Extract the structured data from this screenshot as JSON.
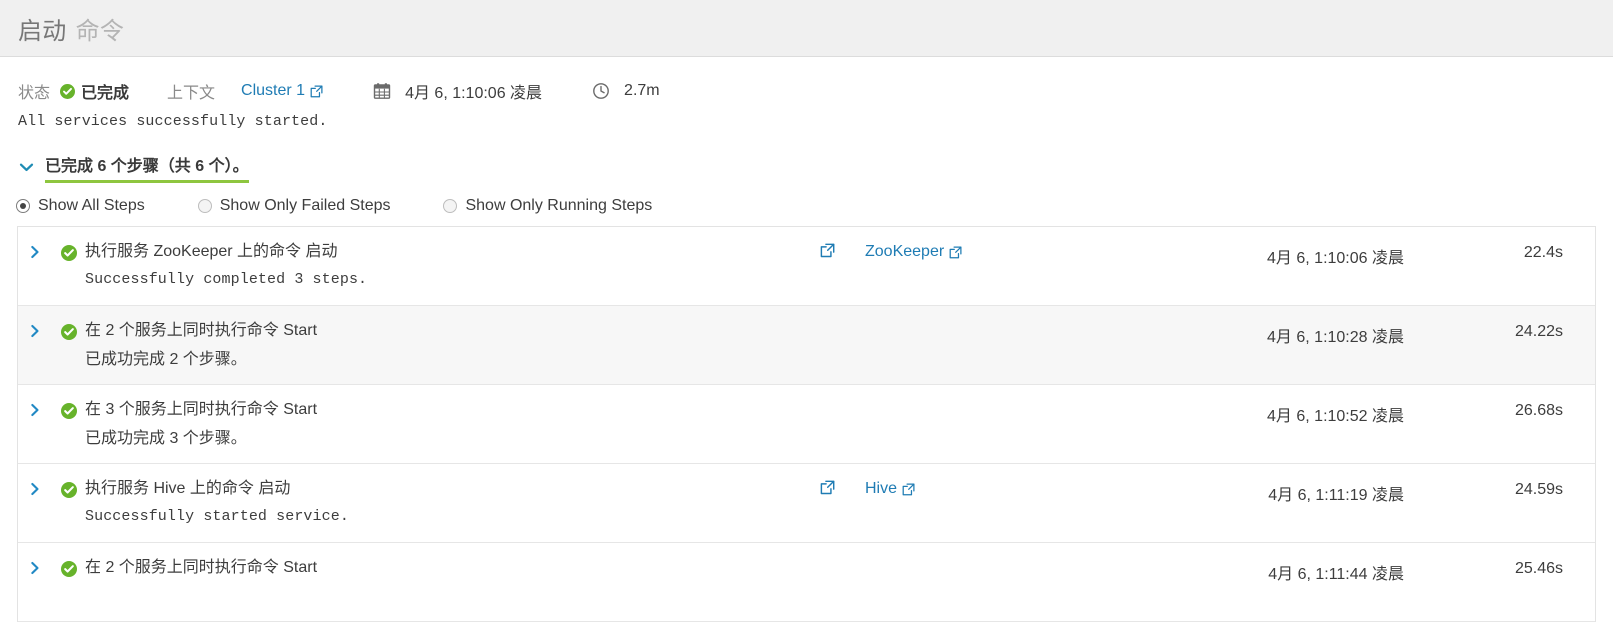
{
  "header": {
    "title_main": "启动",
    "title_sub": "命令"
  },
  "meta": {
    "status_label": "状态",
    "status_value": "已完成",
    "status_icon": "check-circle-icon",
    "context_label": "上下文",
    "context_link": "Cluster 1",
    "context_link_icon": "external-link-icon",
    "calendar_icon": "calendar-icon",
    "start_time": "4月 6, 1:10:06 凌晨",
    "clock_icon": "clock-icon",
    "duration": "2.7m"
  },
  "description": "All services successfully started.",
  "steps_section": {
    "chevron_icon": "chevron-down-icon",
    "summary": "已完成 6 个步骤（共 6 个）。",
    "underline_color": "#8ec63f",
    "filters": [
      {
        "label": "Show All Steps",
        "selected": true
      },
      {
        "label": "Show Only Failed Steps",
        "selected": false
      },
      {
        "label": "Show Only Running Steps",
        "selected": false
      }
    ]
  },
  "steps_table": {
    "rows": [
      {
        "expand_icon": "chevron-right-icon",
        "state_icon": "check-circle-icon",
        "title": "执行服务 ZooKeeper 上的命令 启动",
        "subtitle": "Successfully completed 3 steps.",
        "subtitle_mono": true,
        "detail_icon": "external-link-icon",
        "service_link": "ZooKeeper",
        "service_link_icon": "external-link-icon",
        "time": "4月 6, 1:10:06 凌晨",
        "duration": "22.4s",
        "alt": false
      },
      {
        "expand_icon": "chevron-right-icon",
        "state_icon": "check-circle-icon",
        "title": "在 2 个服务上同时执行命令 Start",
        "subtitle": "已成功完成 2 个步骤。",
        "subtitle_mono": false,
        "detail_icon": "",
        "service_link": "",
        "service_link_icon": "",
        "time": "4月 6, 1:10:28 凌晨",
        "duration": "24.22s",
        "alt": true
      },
      {
        "expand_icon": "chevron-right-icon",
        "state_icon": "check-circle-icon",
        "title": "在 3 个服务上同时执行命令 Start",
        "subtitle": "已成功完成 3 个步骤。",
        "subtitle_mono": false,
        "detail_icon": "",
        "service_link": "",
        "service_link_icon": "",
        "time": "4月 6, 1:10:52 凌晨",
        "duration": "26.68s",
        "alt": false
      },
      {
        "expand_icon": "chevron-right-icon",
        "state_icon": "check-circle-icon",
        "title": "执行服务 Hive 上的命令 启动",
        "subtitle": "Successfully started service.",
        "subtitle_mono": true,
        "detail_icon": "external-link-icon",
        "service_link": "Hive",
        "service_link_icon": "external-link-icon",
        "time": "4月 6, 1:11:19 凌晨",
        "duration": "24.59s",
        "alt": false
      },
      {
        "expand_icon": "chevron-right-icon",
        "state_icon": "check-circle-icon",
        "title": "在 2 个服务上同时执行命令 Start",
        "subtitle": "",
        "subtitle_mono": false,
        "detail_icon": "",
        "service_link": "",
        "service_link_icon": "",
        "time": "4月 6, 1:11:44 凌晨",
        "duration": "25.46s",
        "alt": false
      }
    ]
  },
  "colors": {
    "link": "#1f7cb4",
    "success": "#67b32b",
    "underline": "#8ec63f",
    "chevron": "#2189c4",
    "titlebar_bg": "#f0f0f0"
  }
}
